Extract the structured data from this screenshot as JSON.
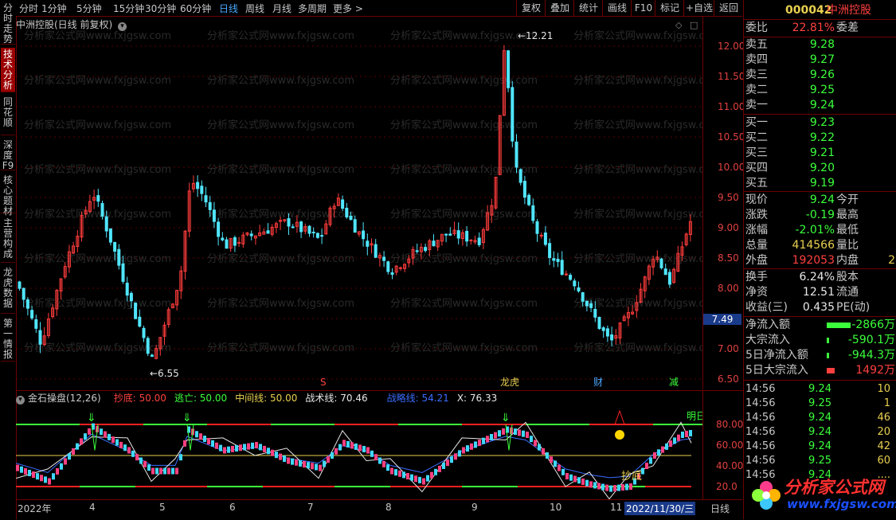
{
  "left_tabs": [
    "分时走势",
    "技术分析",
    "同花顺",
    "深度F9",
    "核心题材",
    "主营构成",
    "龙虎数据",
    "第一情报"
  ],
  "left_active": 1,
  "toolbar": {
    "periods": [
      "分时",
      "1分钟",
      "5分钟",
      "15分钟",
      "30分钟",
      "60分钟",
      "日线",
      "周线",
      "月线",
      "多周期",
      "更多 >"
    ],
    "active_period": "日线",
    "right_buttons": [
      "复权",
      "叠加",
      "统计",
      "画线",
      "F10",
      "标记",
      "+自选",
      "返回"
    ]
  },
  "chart": {
    "title": "中洲控股(日线 前复权)",
    "high_label": "12.21",
    "low_label": "6.55",
    "last_price_box": "7.49",
    "price_ticks": [
      "12.00",
      "11.50",
      "11.00",
      "10.50",
      "10.00",
      "9.50",
      "9.00",
      "8.50",
      "8.00",
      "7.50",
      "7.00",
      "6.50"
    ],
    "markers": [
      {
        "text": "S",
        "color": "#ff4040"
      },
      {
        "text": "龙虎",
        "color": "#e8d050"
      },
      {
        "text": "财",
        "color": "#4aa8ff"
      },
      {
        "text": "减",
        "color": "#3cff3c"
      }
    ],
    "watermark": "分析家公式网www.fxjgsw.com"
  },
  "indicator": {
    "name": "金石操盘(12,26)",
    "items": [
      {
        "label": "抄底: 50.00",
        "color": "#ff4040"
      },
      {
        "label": "逃亡: 50.00",
        "color": "#3cff3c"
      },
      {
        "label": "中间线: 50.00",
        "color": "#e8d050"
      },
      {
        "label": "战术线: 70.46",
        "color": "#e8e8e8"
      },
      {
        "label": "战略线: 54.21",
        "color": "#3a6cff"
      },
      {
        "label": "X: 76.33",
        "color": "#e8e8e8"
      }
    ],
    "ticks": [
      "80.00",
      "60.00",
      "40.00",
      "20.0"
    ],
    "label_buy": "抄底",
    "label_right": "明日"
  },
  "datebar": {
    "labels": [
      "2022年",
      "4",
      "5",
      "6",
      "7",
      "8",
      "9",
      "10",
      "11"
    ],
    "cursor_date": "2022/11/30/三",
    "period": "日线"
  },
  "quote": {
    "code": "000042",
    "name": "中洲控股",
    "weibi_label": "委比",
    "weibi": "22.81%",
    "weicha_label": "委差",
    "asks": [
      {
        "l": "卖五",
        "p": "9.28"
      },
      {
        "l": "卖四",
        "p": "9.27"
      },
      {
        "l": "卖三",
        "p": "9.26"
      },
      {
        "l": "卖二",
        "p": "9.25"
      },
      {
        "l": "卖一",
        "p": "9.24"
      }
    ],
    "bids": [
      {
        "l": "买一",
        "p": "9.23"
      },
      {
        "l": "买二",
        "p": "9.22"
      },
      {
        "l": "买三",
        "p": "9.21"
      },
      {
        "l": "买四",
        "p": "9.20"
      },
      {
        "l": "买五",
        "p": "9.19"
      }
    ],
    "stats": [
      {
        "l": "现价",
        "v": "9.24",
        "c": "green",
        "l2": "今开"
      },
      {
        "l": "涨跌",
        "v": "-0.19",
        "c": "green",
        "l2": "最高"
      },
      {
        "l": "涨幅",
        "v": "-2.01%",
        "c": "green",
        "l2": "最低"
      },
      {
        "l": "总量",
        "v": "414566",
        "c": "yellow",
        "l2": "量比"
      },
      {
        "l": "外盘",
        "v": "192053",
        "c": "red",
        "l2": "内盘",
        "v2": "2"
      }
    ],
    "stats2": [
      {
        "l": "换手",
        "v": "6.24%",
        "c": "white",
        "l2": "股本"
      },
      {
        "l": "净资",
        "v": "12.51",
        "c": "white",
        "l2": "流通"
      },
      {
        "l": "收益(三)",
        "v": "0.435",
        "c": "white",
        "l2": "PE(动)"
      }
    ],
    "flows": [
      {
        "l": "净流入额",
        "v": "-2866万",
        "c": "green",
        "bar": 60
      },
      {
        "l": "大宗流入",
        "v": "-590.1万",
        "c": "green",
        "bar": 5
      },
      {
        "l": "5日净流入额",
        "v": "-944.3万",
        "c": "green",
        "bar": 5
      },
      {
        "l": "5日大宗流入",
        "v": "1492万",
        "c": "red",
        "bar": 20
      }
    ],
    "ticks": [
      {
        "t": "14:56",
        "p": "9.24",
        "v": "10"
      },
      {
        "t": "14:56",
        "p": "9.25",
        "v": "1"
      },
      {
        "t": "14:56",
        "p": "9.24",
        "v": "46"
      },
      {
        "t": "14:56",
        "p": "9.24",
        "v": "20"
      },
      {
        "t": "14:56",
        "p": "9.24",
        "v": "42"
      },
      {
        "t": "14:56",
        "p": "9.25",
        "v": "60"
      },
      {
        "t": "14:56",
        "p": "9.24",
        "v": "...."
      }
    ]
  },
  "logo": {
    "text": "分析家公式网",
    "url": "www.fxjgsw.com"
  }
}
